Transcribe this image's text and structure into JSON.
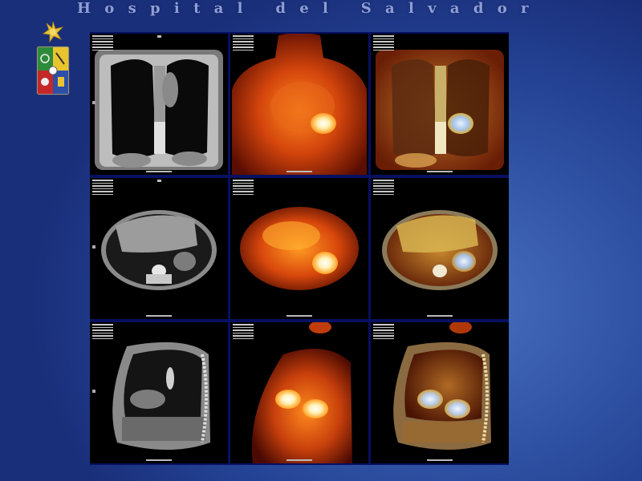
{
  "slide": {
    "title": "Hospital del Salvador"
  },
  "colors": {
    "background": "#3356a8",
    "title": "#8e9ed6",
    "grid_frame": "#081060"
  },
  "logo": {
    "icon": "coat-of-arms-icon"
  },
  "rows": [
    {
      "view": "coronal",
      "panels": [
        "ct",
        "pet",
        "fused"
      ]
    },
    {
      "view": "axial",
      "panels": [
        "ct",
        "pet",
        "fused"
      ]
    },
    {
      "view": "sagittal",
      "panels": [
        "ct",
        "pet",
        "fused"
      ]
    }
  ]
}
